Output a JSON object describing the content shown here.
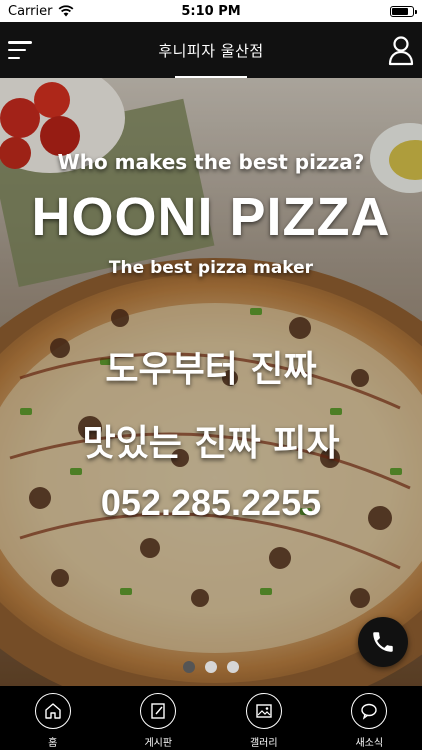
{
  "status": {
    "carrier": "Carrier",
    "time": "5:10 PM",
    "battery_level": 0.85
  },
  "header": {
    "title": "후니피자 울산점",
    "menu_icon": "menu-icon",
    "user_icon": "user-icon"
  },
  "banner": {
    "tagline": "Who makes the best pizza?",
    "brand": "HOONI PIZZA",
    "subtitle": "The best pizza maker",
    "line1": "도우부터 진짜",
    "line2": "맛있는 진짜 피자",
    "phone": "052.285.2255",
    "slides": 3,
    "active_slide": 1
  },
  "call_button": {
    "icon": "phone-icon"
  },
  "nav": {
    "items": [
      {
        "label": "홈",
        "icon": "home-icon"
      },
      {
        "label": "게시판",
        "icon": "board-icon"
      },
      {
        "label": "갤러리",
        "icon": "gallery-icon"
      },
      {
        "label": "새소식",
        "icon": "news-icon"
      }
    ]
  },
  "colors": {
    "header_bg": "#111111",
    "nav_bg": "#000000",
    "dot_active": "#555555",
    "dot_inactive": "#d6d6d6"
  }
}
